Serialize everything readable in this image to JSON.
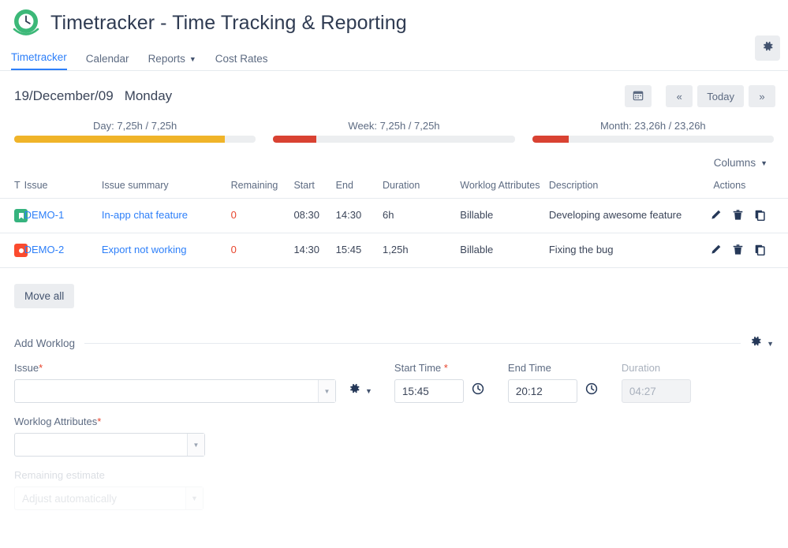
{
  "header": {
    "title": "Timetracker - Time Tracking & Reporting",
    "logo_icon": "clock-logo-icon",
    "settings_icon": "gear-icon"
  },
  "nav": {
    "items": [
      {
        "label": "Timetracker",
        "active": true,
        "has_caret": false
      },
      {
        "label": "Calendar",
        "active": false,
        "has_caret": false
      },
      {
        "label": "Reports",
        "active": false,
        "has_caret": true
      },
      {
        "label": "Cost Rates",
        "active": false,
        "has_caret": false
      }
    ]
  },
  "date_bar": {
    "date": "19/December/09",
    "weekday": "Monday",
    "calendar_icon": "calendar-icon",
    "prev_label": "«",
    "today_label": "Today",
    "next_label": "»"
  },
  "progress": [
    {
      "label": "Day: 7,25h / 7,25h",
      "percent": 87,
      "color": "#f0b429"
    },
    {
      "label": "Week: 7,25h / 7,25h",
      "percent": 18,
      "color": "#d94232"
    },
    {
      "label": "Month: 23,26h / 23,26h",
      "percent": 15,
      "color": "#d94232"
    }
  ],
  "table": {
    "columns_label": "Columns",
    "headers": [
      "T",
      "Issue",
      "Issue summary",
      "Remaining",
      "Start",
      "End",
      "Duration",
      "Worklog Attributes",
      "Description",
      "Actions"
    ],
    "rows": [
      {
        "type_icon": "story-icon",
        "type_color": "#36b37e",
        "issue": "DEMO-1",
        "summary": "In-app chat feature",
        "remaining": "0",
        "start": "08:30",
        "end": "14:30",
        "duration": "6h",
        "attributes": "Billable",
        "description": "Developing awesome feature"
      },
      {
        "type_icon": "bug-icon",
        "type_color": "#fb4b2e",
        "issue": "DEMO-2",
        "summary": "Export not working",
        "remaining": "0",
        "start": "14:30",
        "end": "15:45",
        "duration": "1,25h",
        "attributes": "Billable",
        "description": "Fixing the bug"
      }
    ],
    "action_icons": [
      "edit-pencil-icon",
      "delete-trash-icon",
      "copy-duplicate-icon"
    ]
  },
  "move_all_label": "Move all",
  "add_worklog": {
    "title": "Add Worklog",
    "gear_icon": "gear-icon",
    "issue_label": "Issue",
    "issue_required": "*",
    "issue_value": "",
    "issue_placeholder": "",
    "start_label": "Start Time",
    "start_required": "*",
    "start_value": "15:45",
    "end_label": "End Time",
    "end_value": "20:12",
    "duration_label": "Duration",
    "duration_value": "04:27",
    "attributes_label": "Worklog Attributes",
    "attributes_required": "*",
    "attributes_value": "",
    "remaining_label": "Remaining estimate",
    "remaining_value": "Adjust automatically",
    "clock_icon": "clock-icon"
  }
}
